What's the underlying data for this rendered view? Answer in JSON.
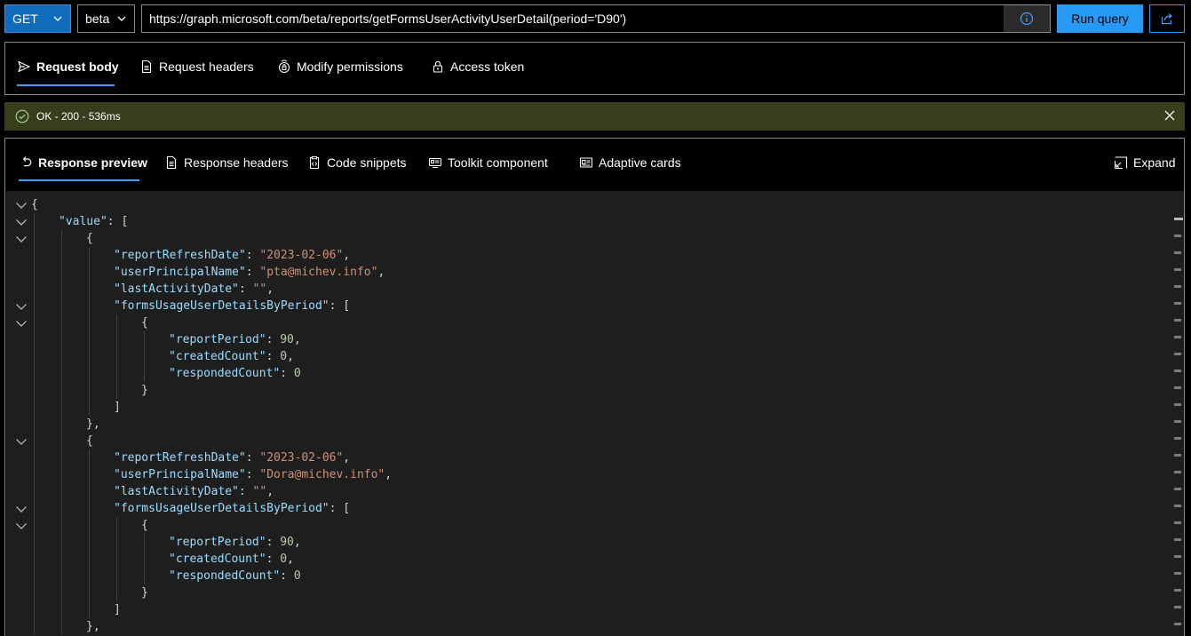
{
  "query": {
    "method": "GET",
    "version": "beta",
    "url": "https://graph.microsoft.com/beta/reports/getFormsUserActivityUserDetail(period='D90')",
    "run_label": "Run query"
  },
  "request_tabs": [
    {
      "label": "Request body",
      "icon": "send-icon"
    },
    {
      "label": "Request headers",
      "icon": "document-icon"
    },
    {
      "label": "Modify permissions",
      "icon": "shield-lock-icon"
    },
    {
      "label": "Access token",
      "icon": "lock-icon"
    }
  ],
  "status": {
    "text": "OK - 200 - 536ms",
    "color": "#393d1b"
  },
  "response_tabs": [
    {
      "label": "Response preview",
      "icon": "undo-arrow-icon"
    },
    {
      "label": "Response headers",
      "icon": "document-icon"
    },
    {
      "label": "Code snippets",
      "icon": "clipboard-code-icon"
    },
    {
      "label": "Toolkit component",
      "icon": "toolkit-icon"
    },
    {
      "label": "Adaptive cards",
      "icon": "card-icon"
    }
  ],
  "expand_label": "Expand",
  "json_lines": [
    {
      "indent": 0,
      "fold": true,
      "tokens": [
        [
          "p",
          "{"
        ]
      ]
    },
    {
      "indent": 1,
      "fold": true,
      "tokens": [
        [
          "k",
          "\"value\""
        ],
        [
          "p",
          ": ["
        ]
      ]
    },
    {
      "indent": 2,
      "fold": true,
      "tokens": [
        [
          "p",
          "{"
        ]
      ]
    },
    {
      "indent": 3,
      "fold": false,
      "tokens": [
        [
          "k",
          "\"reportRefreshDate\""
        ],
        [
          "p",
          ": "
        ],
        [
          "s",
          "\"2023-02-06\""
        ],
        [
          "p",
          ","
        ]
      ]
    },
    {
      "indent": 3,
      "fold": false,
      "tokens": [
        [
          "k",
          "\"userPrincipalName\""
        ],
        [
          "p",
          ": "
        ],
        [
          "s",
          "\"pta@michev.info\""
        ],
        [
          "p",
          ","
        ]
      ]
    },
    {
      "indent": 3,
      "fold": false,
      "tokens": [
        [
          "k",
          "\"lastActivityDate\""
        ],
        [
          "p",
          ": "
        ],
        [
          "s",
          "\"\""
        ],
        [
          "p",
          ","
        ]
      ]
    },
    {
      "indent": 3,
      "fold": true,
      "tokens": [
        [
          "k",
          "\"formsUsageUserDetailsByPeriod\""
        ],
        [
          "p",
          ": ["
        ]
      ]
    },
    {
      "indent": 4,
      "fold": true,
      "tokens": [
        [
          "p",
          "{"
        ]
      ]
    },
    {
      "indent": 5,
      "fold": false,
      "tokens": [
        [
          "k",
          "\"reportPeriod\""
        ],
        [
          "p",
          ": "
        ],
        [
          "n",
          "90"
        ],
        [
          "p",
          ","
        ]
      ]
    },
    {
      "indent": 5,
      "fold": false,
      "tokens": [
        [
          "k",
          "\"createdCount\""
        ],
        [
          "p",
          ": "
        ],
        [
          "n",
          "0"
        ],
        [
          "p",
          ","
        ]
      ]
    },
    {
      "indent": 5,
      "fold": false,
      "tokens": [
        [
          "k",
          "\"respondedCount\""
        ],
        [
          "p",
          ": "
        ],
        [
          "n",
          "0"
        ]
      ]
    },
    {
      "indent": 4,
      "fold": false,
      "tokens": [
        [
          "p",
          "}"
        ]
      ]
    },
    {
      "indent": 3,
      "fold": false,
      "tokens": [
        [
          "p",
          "]"
        ]
      ]
    },
    {
      "indent": 2,
      "fold": false,
      "tokens": [
        [
          "p",
          "},"
        ]
      ]
    },
    {
      "indent": 2,
      "fold": true,
      "tokens": [
        [
          "p",
          "{"
        ]
      ]
    },
    {
      "indent": 3,
      "fold": false,
      "tokens": [
        [
          "k",
          "\"reportRefreshDate\""
        ],
        [
          "p",
          ": "
        ],
        [
          "s",
          "\"2023-02-06\""
        ],
        [
          "p",
          ","
        ]
      ]
    },
    {
      "indent": 3,
      "fold": false,
      "tokens": [
        [
          "k",
          "\"userPrincipalName\""
        ],
        [
          "p",
          ": "
        ],
        [
          "s",
          "\"Dora@michev.info\""
        ],
        [
          "p",
          ","
        ]
      ]
    },
    {
      "indent": 3,
      "fold": false,
      "tokens": [
        [
          "k",
          "\"lastActivityDate\""
        ],
        [
          "p",
          ": "
        ],
        [
          "s",
          "\"\""
        ],
        [
          "p",
          ","
        ]
      ]
    },
    {
      "indent": 3,
      "fold": true,
      "tokens": [
        [
          "k",
          "\"formsUsageUserDetailsByPeriod\""
        ],
        [
          "p",
          ": ["
        ]
      ]
    },
    {
      "indent": 4,
      "fold": true,
      "tokens": [
        [
          "p",
          "{"
        ]
      ]
    },
    {
      "indent": 5,
      "fold": false,
      "tokens": [
        [
          "k",
          "\"reportPeriod\""
        ],
        [
          "p",
          ": "
        ],
        [
          "n",
          "90"
        ],
        [
          "p",
          ","
        ]
      ]
    },
    {
      "indent": 5,
      "fold": false,
      "tokens": [
        [
          "k",
          "\"createdCount\""
        ],
        [
          "p",
          ": "
        ],
        [
          "n",
          "0"
        ],
        [
          "p",
          ","
        ]
      ]
    },
    {
      "indent": 5,
      "fold": false,
      "tokens": [
        [
          "k",
          "\"respondedCount\""
        ],
        [
          "p",
          ": "
        ],
        [
          "n",
          "0"
        ]
      ]
    },
    {
      "indent": 4,
      "fold": false,
      "tokens": [
        [
          "p",
          "}"
        ]
      ]
    },
    {
      "indent": 3,
      "fold": false,
      "tokens": [
        [
          "p",
          "]"
        ]
      ]
    },
    {
      "indent": 2,
      "fold": false,
      "tokens": [
        [
          "p",
          "},"
        ]
      ]
    }
  ]
}
